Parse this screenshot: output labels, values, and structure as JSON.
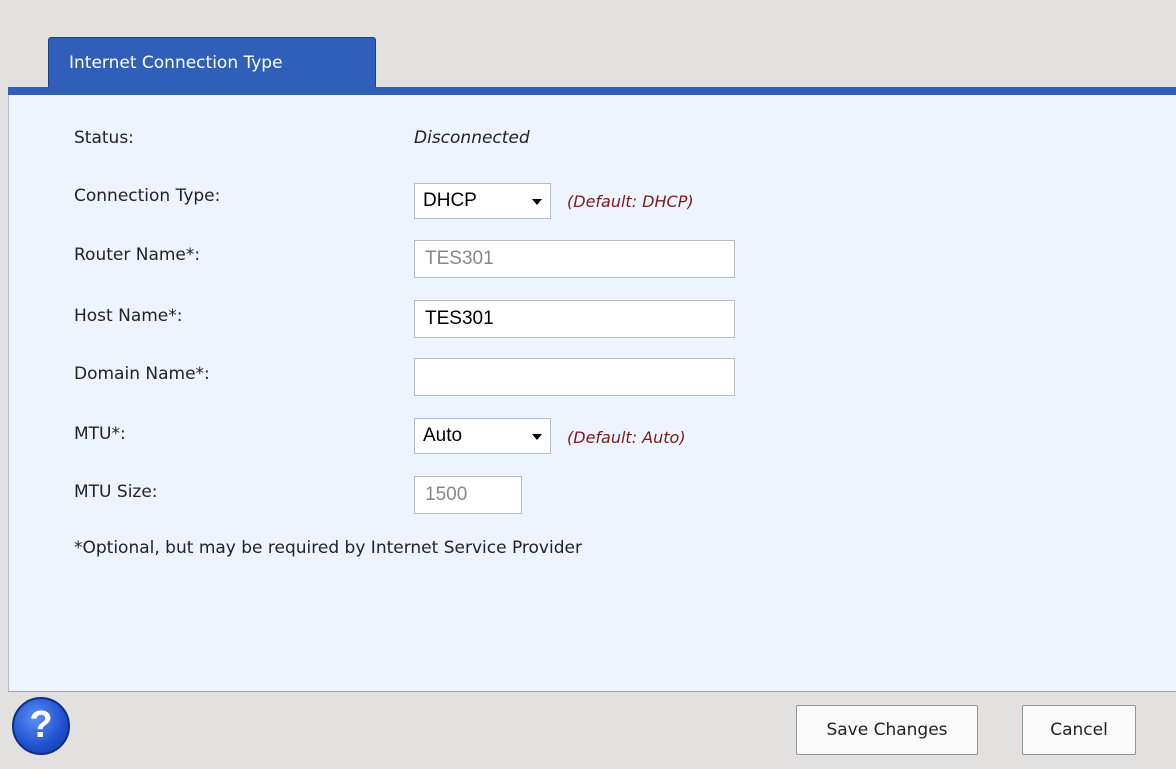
{
  "tab": {
    "label": "Internet Connection Type"
  },
  "form": {
    "status_label": "Status:",
    "status_value": "Disconnected",
    "connection_type_label": "Connection Type:",
    "connection_type_value": "DHCP",
    "connection_type_hint": "(Default: DHCP)",
    "router_name_label": "Router Name*:",
    "router_name_value": "TES301",
    "host_name_label": "Host Name*:",
    "host_name_value": "TES301",
    "domain_name_label": "Domain Name*:",
    "domain_name_value": "",
    "mtu_label": "MTU*:",
    "mtu_value": "Auto",
    "mtu_hint": "(Default: Auto)",
    "mtu_size_label": "MTU Size:",
    "mtu_size_value": "1500",
    "note": "*Optional, but may be required by Internet Service Provider"
  },
  "footer": {
    "help_icon_glyph": "?",
    "save_label": "Save Changes",
    "cancel_label": "Cancel"
  }
}
